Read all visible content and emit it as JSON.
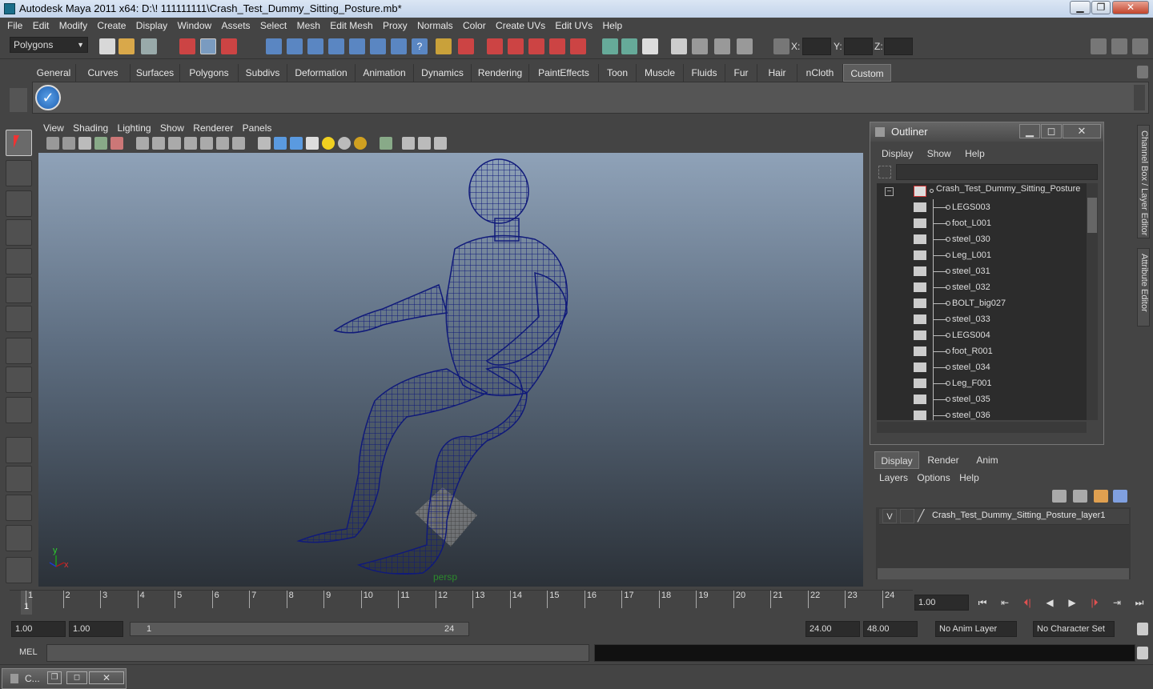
{
  "window": {
    "title": "Autodesk Maya 2011 x64: D:\\! 111111111\\Crash_Test_Dummy_Sitting_Posture.mb*",
    "min": "▁",
    "max": "❐",
    "close": "✕"
  },
  "menubar": [
    "File",
    "Edit",
    "Modify",
    "Create",
    "Display",
    "Window",
    "Assets",
    "Select",
    "Mesh",
    "Edit Mesh",
    "Proxy",
    "Normals",
    "Color",
    "Create UVs",
    "Edit UVs",
    "Help"
  ],
  "status": {
    "mode": "Polygons",
    "x_label": "X:",
    "y_label": "Y:",
    "z_label": "Z:"
  },
  "shelf_tabs": [
    "General",
    "Curves",
    "Surfaces",
    "Polygons",
    "Subdivs",
    "Deformation",
    "Animation",
    "Dynamics",
    "Rendering",
    "PaintEffects",
    "Toon",
    "Muscle",
    "Fluids",
    "Fur",
    "Hair",
    "nCloth",
    "Custom"
  ],
  "shelf_active": "Custom",
  "viewport": {
    "menu": [
      "View",
      "Shading",
      "Lighting",
      "Show",
      "Renderer",
      "Panels"
    ],
    "camera": "persp",
    "axis_y": "y",
    "axis_x": "x",
    "wire_color": "#101a7a"
  },
  "outliner": {
    "title": "Outliner",
    "menu": [
      "Display",
      "Show",
      "Help"
    ],
    "root": "Crash_Test_Dummy_Sitting_Posture",
    "items": [
      "LEGS003",
      "foot_L001",
      "steel_030",
      "Leg_L001",
      "steel_031",
      "steel_032",
      "BOLT_big027",
      "steel_033",
      "LEGS004",
      "foot_R001",
      "steel_034",
      "Leg_F001",
      "steel_035",
      "steel_036"
    ]
  },
  "side_tabs": [
    "Channel Box / Layer Editor",
    "Attribute Editor"
  ],
  "layers": {
    "tabs": [
      "Display",
      "Render",
      "Anim"
    ],
    "active_tab": "Display",
    "menu": [
      "Layers",
      "Options",
      "Help"
    ],
    "layer_name": "Crash_Test_Dummy_Sitting_Posture_layer1",
    "visible_flag": "V"
  },
  "timeline": {
    "ticks": [
      "1",
      "2",
      "3",
      "4",
      "5",
      "6",
      "7",
      "8",
      "9",
      "10",
      "11",
      "12",
      "13",
      "14",
      "15",
      "16",
      "17",
      "18",
      "19",
      "20",
      "21",
      "22",
      "23",
      "24"
    ],
    "current_frame": "1",
    "current_field": "1.00"
  },
  "range": {
    "start": "1.00",
    "start_inner": "1.00",
    "slider_start": "1",
    "slider_end": "24",
    "end_inner": "24.00",
    "end": "48.00",
    "anim_layer": "No Anim Layer",
    "char_set": "No Character Set"
  },
  "cmd": {
    "label": "MEL"
  },
  "taskbar": {
    "item": "C..."
  },
  "playback": [
    "⏮",
    "⇤",
    "⏴|",
    "◀",
    "▶",
    "|⏵",
    "⇥",
    "⏭"
  ]
}
